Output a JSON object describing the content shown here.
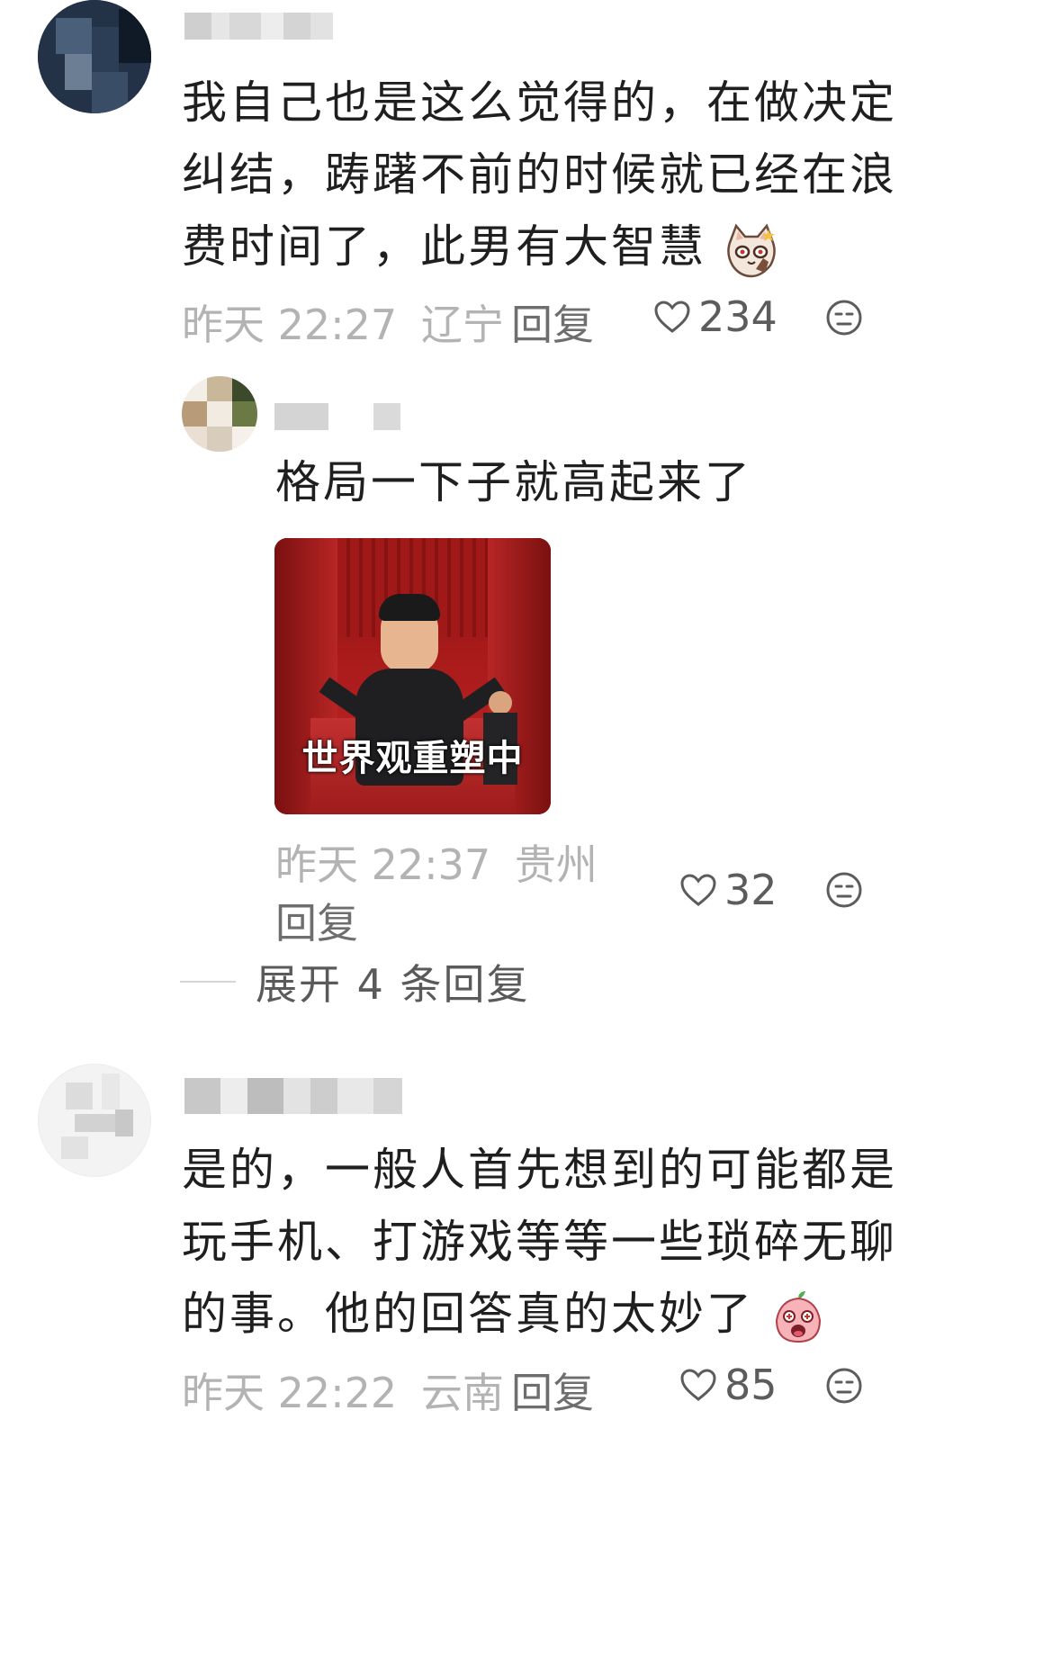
{
  "comments": [
    {
      "text_lines": [
        "我自己也是这么觉得的，在做决定",
        "纠结，踌躇不前的时候就已经在浪",
        "费时间了，此男有大智慧"
      ],
      "emoji": "cat-sticker-icon",
      "time": "昨天 22:27",
      "location": "辽宁",
      "reply_label": "回复",
      "likes": "234"
    },
    {
      "text_lines": [
        "是的，一般人首先想到的可能都是",
        "玩手机、打游戏等等一些琐碎无聊",
        "的事。他的回答真的太妙了"
      ],
      "emoji": "peach-sticker-icon",
      "time": "昨天 22:22",
      "location": "云南",
      "reply_label": "回复",
      "likes": "85"
    }
  ],
  "reply": {
    "text": "格局一下子就高起来了",
    "image_caption": "世界观重塑中",
    "time": "昨天 22:37",
    "location": "贵州",
    "reply_label": "回复",
    "likes": "32"
  },
  "expand_replies": "展开 4 条回复",
  "colors": {
    "text": "#1f1f1f",
    "meta": "#b3b3b3",
    "action": "#6e6e6e",
    "sticker_red": "#b01818"
  }
}
